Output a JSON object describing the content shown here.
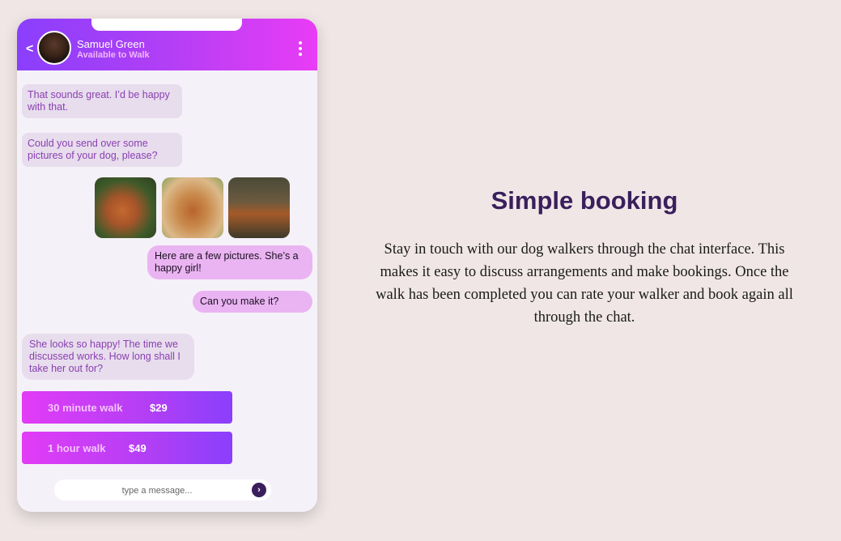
{
  "chat": {
    "contact_name": "Samuel Green",
    "contact_status": "Available to Walk",
    "back_label": "<",
    "messages": [
      {
        "from": "walker",
        "text": "That sounds great. I’d be happy with that."
      },
      {
        "from": "walker",
        "text": "Could you send over some pictures of your dog, please?"
      },
      {
        "from": "owner",
        "text": "Here are a few pictures. She’s a happy girl!"
      },
      {
        "from": "owner",
        "text": "Can you make it?"
      },
      {
        "from": "walker",
        "text": "She looks so happy! The time we discussed works. How long shall I take her out for?"
      }
    ],
    "photos": [
      "dog-photo-1",
      "dog-photo-2",
      "dog-photo-3"
    ],
    "options": [
      {
        "label": "30 minute walk",
        "price": "$29"
      },
      {
        "label": "1 hour walk",
        "price": "$49"
      }
    ],
    "input_placeholder": "type a message...",
    "send_icon": "›"
  },
  "feature": {
    "title": "Simple booking",
    "description": "Stay in touch with our dog walkers through the chat interface. This makes it easy to discuss arrangements and make bookings. Once the walk has been completed you can rate your walker and book again all through the chat."
  },
  "colors": {
    "background": "#f0e6e6",
    "accent_purple": "#8a3ffc",
    "accent_pink": "#e93cf5",
    "title": "#3a1f5c"
  }
}
